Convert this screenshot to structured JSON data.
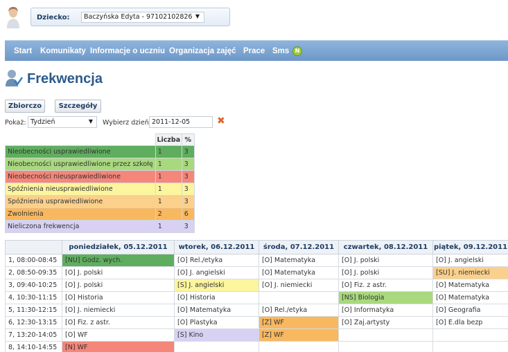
{
  "colors": {
    "green": "#5fae5f",
    "light_green": "#a9d97f",
    "red": "#f4877a",
    "yellow": "#fbf59e",
    "orange": "#fbd08c",
    "orange_dark": "#f8b860",
    "lavender": "#d8d1f3",
    "white": "#ffffff"
  },
  "header": {
    "child_label": "Dziecko:",
    "child_value": "Baczyńska Edyta - 97102102826"
  },
  "nav": {
    "items": [
      "Start",
      "Komunikaty",
      "Informacje o uczniu",
      "Organizacja zajęć",
      "Prace",
      "Sms"
    ],
    "sms_badge": "N"
  },
  "page": {
    "title": "Frekwencja"
  },
  "buttons": {
    "summary": "Zbiorczo",
    "details": "Szczegóły"
  },
  "filters": {
    "show_label": "Pokaż:",
    "show_value": "Tydzień",
    "day_label": "Wybierz dzień:",
    "day_value": "2011-12-05"
  },
  "legend": {
    "headers": [
      "Liczba",
      "%"
    ],
    "rows": [
      {
        "label": "Nieobecności usprawiedliwione",
        "count": "1",
        "pct": "3",
        "color": "green"
      },
      {
        "label": "Nieobecności usprawiedliwione przez szkołę",
        "count": "1",
        "pct": "3",
        "color": "light_green"
      },
      {
        "label": "Nieobecności nieusprawiedliwione",
        "count": "1",
        "pct": "3",
        "color": "red"
      },
      {
        "label": "Spóźnienia nieusprawiedliwione",
        "count": "1",
        "pct": "3",
        "color": "yellow"
      },
      {
        "label": "Spóźnienia usprawiedliwione",
        "count": "1",
        "pct": "3",
        "color": "orange"
      },
      {
        "label": "Zwolnienia",
        "count": "2",
        "pct": "6",
        "color": "orange_dark"
      },
      {
        "label": "Nieliczona frekwencja",
        "count": "1",
        "pct": "3",
        "color": "lavender"
      }
    ]
  },
  "schedule": {
    "days": [
      "poniedziałek, 05.12.2011",
      "wtorek, 06.12.2011",
      "środa, 07.12.2011",
      "czwartek, 08.12.2011",
      "piątek, 09.12.2011"
    ],
    "rows": [
      {
        "period": "1, 08:00-08:45",
        "cells": [
          {
            "text": "[NU] Godz. wych.",
            "color": "green"
          },
          {
            "text": "[O] Rel./etyka",
            "color": "white"
          },
          {
            "text": "[O] Matematyka",
            "color": "white"
          },
          {
            "text": "[O] J. polski",
            "color": "white"
          },
          {
            "text": "[O] J. angielski",
            "color": "white"
          }
        ]
      },
      {
        "period": "2, 08:50-09:35",
        "cells": [
          {
            "text": "[O] J. polski",
            "color": "white"
          },
          {
            "text": "[O] J. angielski",
            "color": "white"
          },
          {
            "text": "[O] Matematyka",
            "color": "white"
          },
          {
            "text": "[O] J. polski",
            "color": "white"
          },
          {
            "text": "[SU] J. niemiecki",
            "color": "orange"
          }
        ]
      },
      {
        "period": "3, 09:40-10:25",
        "cells": [
          {
            "text": "[O] J. polski",
            "color": "white"
          },
          {
            "text": "[S] J. angielski",
            "color": "yellow"
          },
          {
            "text": "[O] J. niemiecki",
            "color": "white"
          },
          {
            "text": "[O] Fiz. z astr.",
            "color": "white"
          },
          {
            "text": "[O] Matematyka",
            "color": "white"
          }
        ]
      },
      {
        "period": "4, 10:30-11:15",
        "cells": [
          {
            "text": "[O] Historia",
            "color": "white"
          },
          {
            "text": "[O] Historia",
            "color": "white"
          },
          {
            "text": "",
            "color": "white"
          },
          {
            "text": "[NS] Biologia",
            "color": "light_green"
          },
          {
            "text": "[O] Matematyka",
            "color": "white"
          }
        ]
      },
      {
        "period": "5, 11:30-12:15",
        "cells": [
          {
            "text": "[O] J. niemiecki",
            "color": "white"
          },
          {
            "text": "[O] Matematyka",
            "color": "white"
          },
          {
            "text": "[O] Rel./etyka",
            "color": "white"
          },
          {
            "text": "[O] Informatyka",
            "color": "white"
          },
          {
            "text": "[O] Geografia",
            "color": "white"
          }
        ]
      },
      {
        "period": "6, 12:30-13:15",
        "cells": [
          {
            "text": "[O] Fiz. z astr.",
            "color": "white"
          },
          {
            "text": "[O] Plastyka",
            "color": "white"
          },
          {
            "text": "[Z] WF",
            "color": "orange_dark"
          },
          {
            "text": "[O] Zaj.artysty",
            "color": "white"
          },
          {
            "text": "[O] E.dla bezp",
            "color": "white"
          }
        ]
      },
      {
        "period": "7, 13:20-14:05",
        "cells": [
          {
            "text": "[O] WF",
            "color": "white"
          },
          {
            "text": "[S] Kino",
            "color": "lavender"
          },
          {
            "text": "[Z] WF",
            "color": "orange_dark"
          },
          {
            "text": "",
            "color": "white"
          },
          {
            "text": "",
            "color": "white"
          }
        ]
      },
      {
        "period": "8, 14:10-14:55",
        "cells": [
          {
            "text": "[N] WF",
            "color": "red"
          },
          {
            "text": "",
            "color": "white"
          },
          {
            "text": "",
            "color": "white"
          },
          {
            "text": "",
            "color": "white"
          },
          {
            "text": "",
            "color": "white"
          }
        ]
      }
    ]
  }
}
